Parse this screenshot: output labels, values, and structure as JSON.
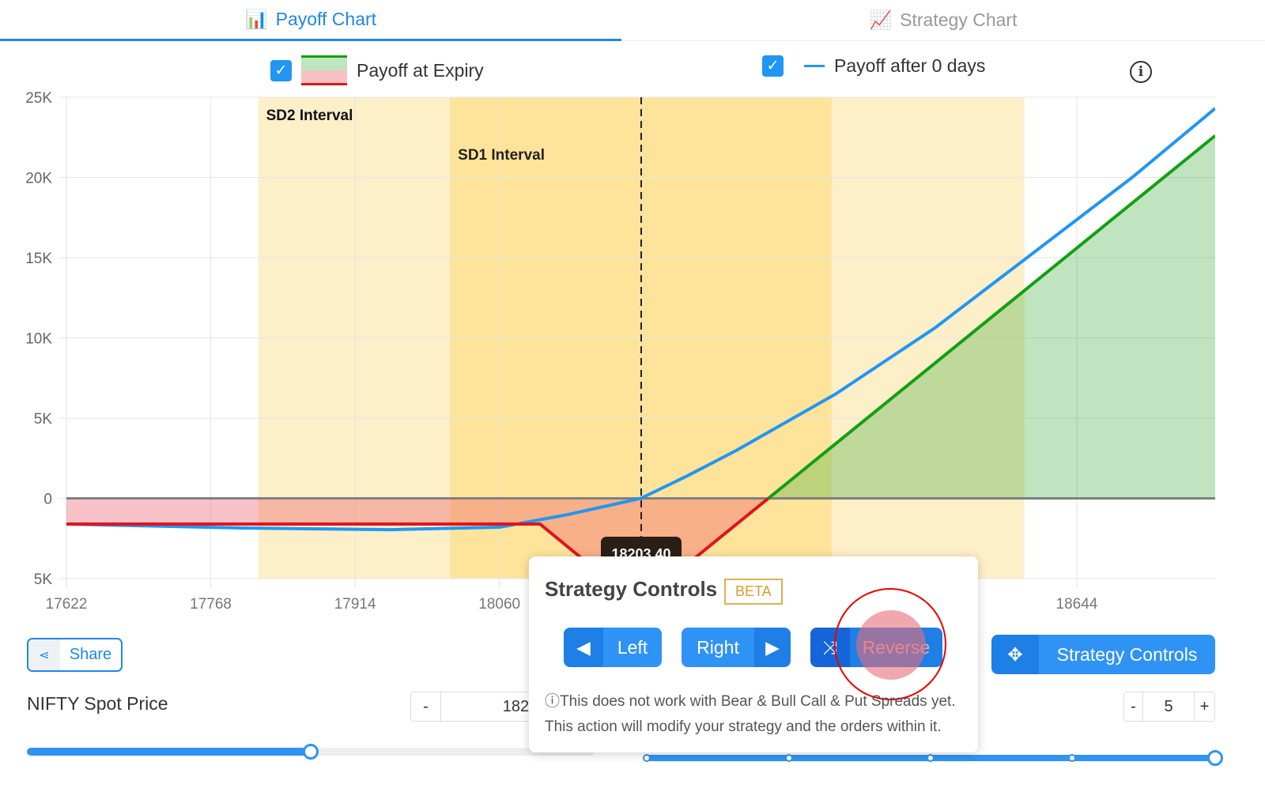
{
  "tabs": [
    {
      "label": "Payoff Chart",
      "icon": "bar-chart-icon",
      "active": true
    },
    {
      "label": "Strategy Chart",
      "icon": "line-chart-icon",
      "active": false
    }
  ],
  "legend": {
    "expiry_label": "Payoff at Expiry",
    "after_label": "Payoff after 0 days",
    "expiry_checked": true,
    "after_checked": true
  },
  "chart_data": {
    "type": "line",
    "xlim": [
      17622,
      18784
    ],
    "ylim": [
      -5000,
      25000
    ],
    "x_ticks": [
      "17622",
      "17768",
      "17914",
      "18060",
      "18644"
    ],
    "y_ticks": [
      "25K",
      "20K",
      "15K",
      "10K",
      "5K",
      "0",
      "5K"
    ],
    "y_tick_values": [
      25000,
      20000,
      15000,
      10000,
      5000,
      0,
      -5000
    ],
    "x_tick_values": [
      17622,
      17768,
      17914,
      18060,
      18644
    ],
    "grid": true,
    "bands": [
      {
        "label": "SD2 Interval",
        "from": 17816,
        "to": 18591,
        "color": "#fdefc8"
      },
      {
        "label": "SD1 Interval",
        "from": 18010,
        "to": 18396,
        "color": "#fde49a"
      }
    ],
    "series": [
      {
        "name": "Payoff at Expiry",
        "color": "#e0141e",
        "points": [
          [
            17622,
            -1600
          ],
          [
            18101,
            -1600
          ],
          [
            18200,
            -6600
          ],
          [
            18332,
            0
          ],
          [
            18784,
            22600
          ]
        ]
      },
      {
        "name": "Payoff after 0 days",
        "color": "#2196f3",
        "points": [
          [
            17622,
            -1600
          ],
          [
            17800,
            -1850
          ],
          [
            17950,
            -1950
          ],
          [
            18060,
            -1800
          ],
          [
            18130,
            -1000
          ],
          [
            18203,
            0
          ],
          [
            18250,
            1400
          ],
          [
            18300,
            3000
          ],
          [
            18400,
            6500
          ],
          [
            18500,
            10600
          ],
          [
            18600,
            15300
          ],
          [
            18700,
            20000
          ],
          [
            18784,
            24300
          ]
        ]
      }
    ],
    "current_price": 18203.4,
    "current_price_label": "18203.40"
  },
  "share_label": "Share",
  "spot": {
    "label": "NIFTY Spot Price",
    "value": "18203.4",
    "minus": "-",
    "slider_fraction": 0.5
  },
  "days": {
    "value": "5",
    "minus": "-",
    "plus": "+",
    "slider_fraction": 1.0
  },
  "popup": {
    "title": "Strategy Controls",
    "badge": "BETA",
    "left": "Left",
    "right": "Right",
    "reverse": "Reverse",
    "note1": "This does not work with Bear & Bull Call & Put Spreads yet.",
    "note2": "This action will modify your strategy and the orders within it."
  },
  "strategy_controls_button": "Strategy Controls",
  "colors": {
    "accent": "#2196f3",
    "green": "#12a012",
    "red": "#e0141e"
  }
}
